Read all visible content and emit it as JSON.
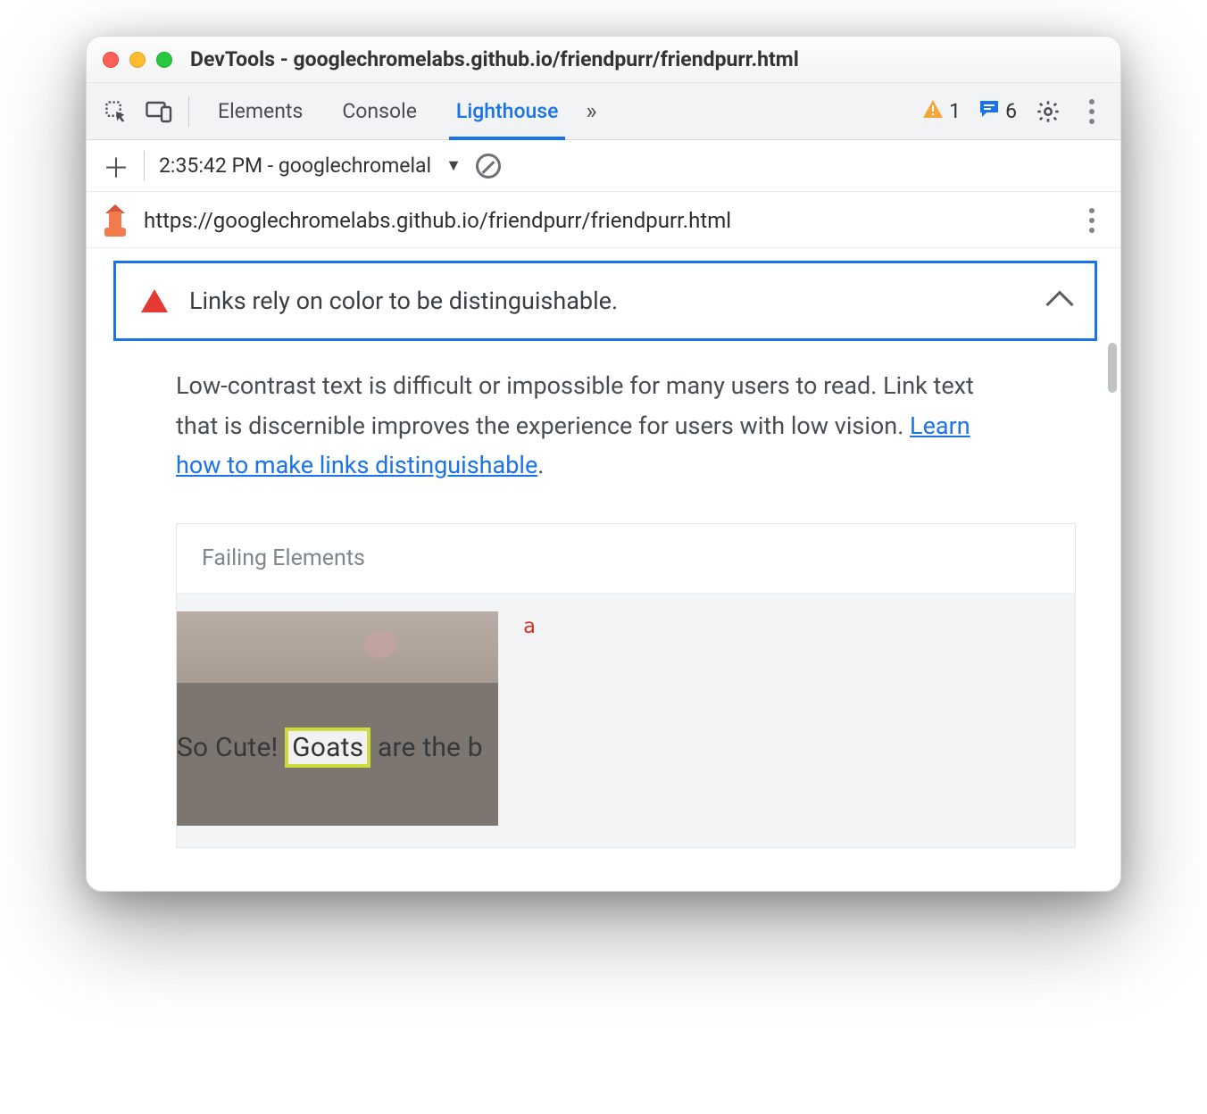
{
  "window": {
    "title": "DevTools - googlechromelabs.github.io/friendpurr/friendpurr.html"
  },
  "toolbar": {
    "tabs": {
      "elements": "Elements",
      "console": "Console",
      "lighthouse": "Lighthouse"
    },
    "overflow": "»",
    "warnings_count": "1",
    "messages_count": "6"
  },
  "report_selector": {
    "label": "2:35:42 PM - googlechromelal"
  },
  "url_row": {
    "url": "https://googlechromelabs.github.io/friendpurr/friendpurr.html"
  },
  "audit": {
    "title": "Links rely on color to be distinguishable.",
    "description_a": "Low-contrast text is difficult or impossible for many users to read. Link text that is discernible improves the experience for users with low vision. ",
    "learn_link": "Learn how to make links distinguishable",
    "description_end": "."
  },
  "failing": {
    "header": "Failing Elements",
    "tag": "a",
    "snippet_before": "So Cute! ",
    "snippet_highlight": "Goats",
    "snippet_after": " are the b"
  }
}
